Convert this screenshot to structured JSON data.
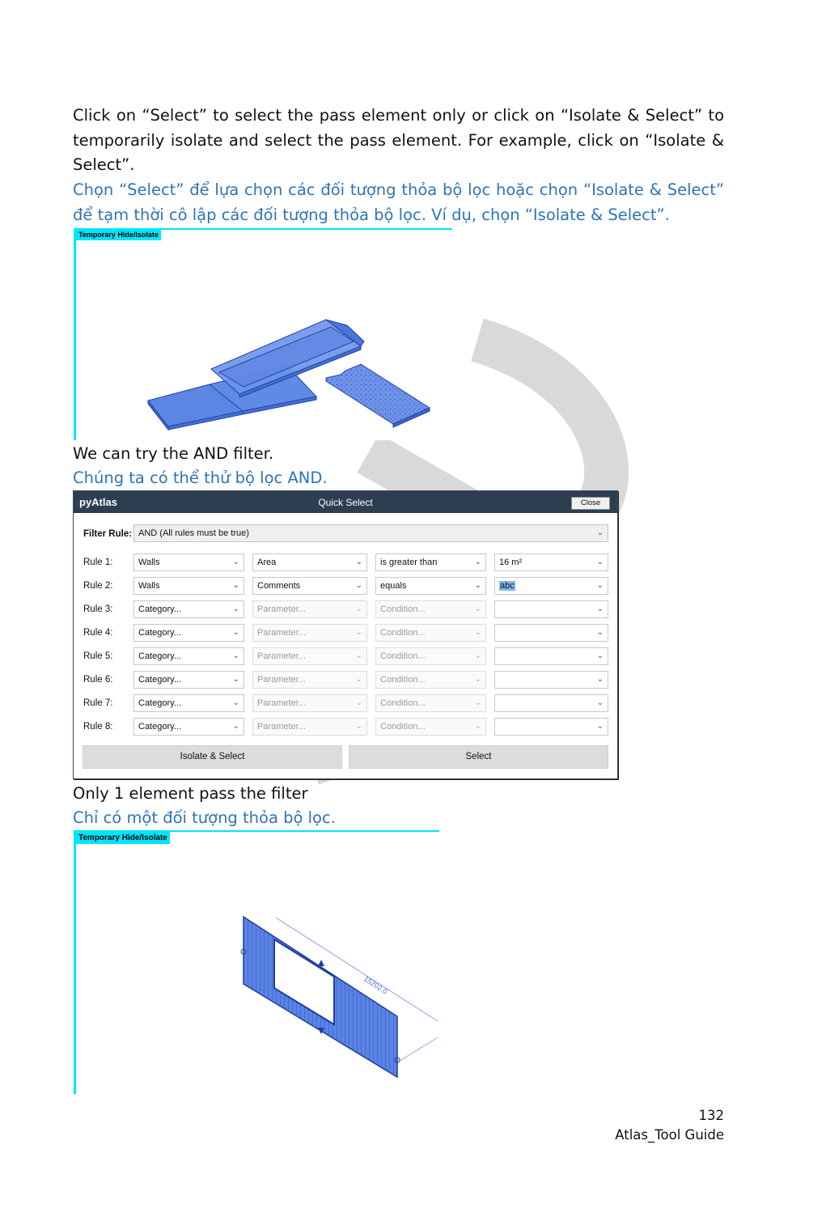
{
  "paragraph1": {
    "en": "Click on “Select” to select the pass element only or click on “Isolate & Select” to temporarily isolate and select the pass element. For example, click on “Isolate & Select”.",
    "vi": "Chọn “Select” để lựa chọn các đối tượng thỏa bộ lọc hoặc chọn “Isolate & Select” để tạm thời cô lập các đối tượng thỏa bộ lọc. Ví dụ, chọn “Isolate & Select”."
  },
  "viewport1": {
    "tag": "Temporary Hide/Isolate"
  },
  "paragraph2": {
    "en": "We can try the AND filter.",
    "vi": "Chúng ta có thể thử bộ lọc AND."
  },
  "dialog": {
    "brand": "pyAtlas",
    "title": "Quick Select",
    "close_label": "Close",
    "filter_rule_label": "Filter Rule:",
    "filter_rule_value": "AND (All rules must be true)",
    "rules": [
      {
        "label": "Rule 1:",
        "category": "Walls",
        "parameter": "Area",
        "condition": "is greater than",
        "value": "16 m²",
        "active": true
      },
      {
        "label": "Rule 2:",
        "category": "Walls",
        "parameter": "Comments",
        "condition": "equals",
        "value": "abc",
        "active": true
      },
      {
        "label": "Rule 3:",
        "category": "Category...",
        "parameter": "Parameter...",
        "condition": "Condition...",
        "value": "",
        "active": false
      },
      {
        "label": "Rule 4:",
        "category": "Category...",
        "parameter": "Parameter...",
        "condition": "Condition...",
        "value": "",
        "active": false
      },
      {
        "label": "Rule 5:",
        "category": "Category...",
        "parameter": "Parameter...",
        "condition": "Condition...",
        "value": "",
        "active": false
      },
      {
        "label": "Rule 6:",
        "category": "Category...",
        "parameter": "Parameter...",
        "condition": "Condition...",
        "value": "",
        "active": false
      },
      {
        "label": "Rule 7:",
        "category": "Category...",
        "parameter": "Parameter...",
        "condition": "Condition...",
        "value": "",
        "active": false
      },
      {
        "label": "Rule 8:",
        "category": "Category...",
        "parameter": "Parameter...",
        "condition": "Condition...",
        "value": "",
        "active": false
      }
    ],
    "isolate_select_label": "Isolate & Select",
    "select_label": "Select"
  },
  "paragraph3": {
    "en": "Only 1 element pass the filter",
    "vi": "Chỉ có một đối tượng thỏa bộ lọc."
  },
  "viewport2": {
    "tag": "Temporary Hide/Isolate",
    "dimension": "15202.0"
  },
  "footer": {
    "page_number": "132",
    "doc_title": "Atlas_Tool Guide"
  },
  "colors": {
    "vietnamese_text": "#2e74b5",
    "isolate_frame": "#00e5ff",
    "dialog_titlebar": "#2d3e50",
    "element_fill": "#4f7fe0"
  }
}
